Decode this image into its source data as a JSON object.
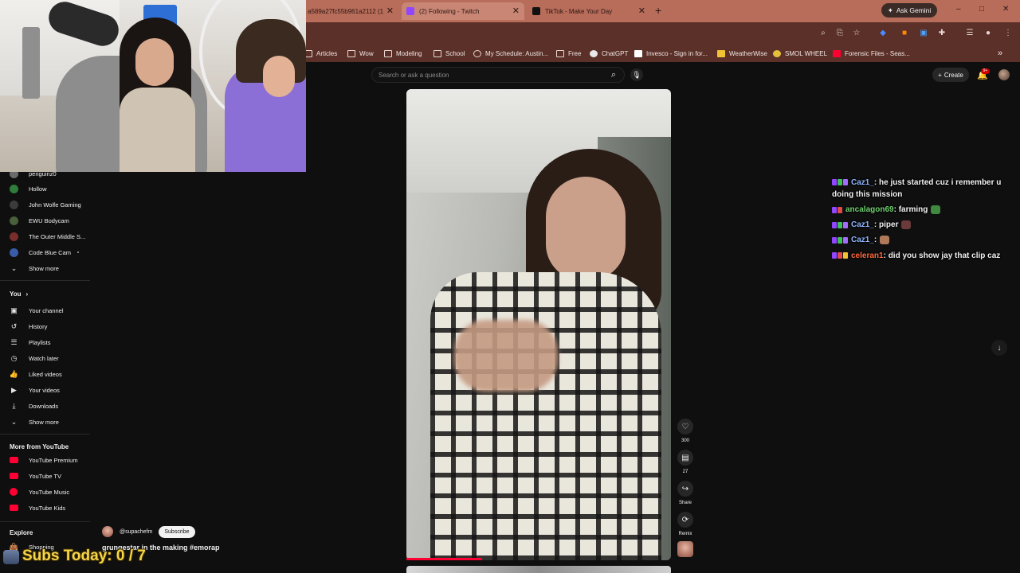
{
  "browser": {
    "tabs": [
      {
        "title": "a589a27fc55b961a2112 (1",
        "active": false,
        "icon_color": "#8a3b2e"
      },
      {
        "title": "(2) Following - Twitch",
        "active": true,
        "icon_color": "#9146ff"
      },
      {
        "title": "TikTok - Make Your Day",
        "active": false,
        "icon_color": "#111111"
      }
    ],
    "new_tab": "+",
    "ask_gemini": "Ask Gemini",
    "win_controls": [
      "–",
      "□",
      "✕"
    ],
    "bookmarks": [
      "Articles",
      "Wow",
      "Modeling",
      "School",
      "My Schedule: Austin...",
      "Free",
      "ChatGPT",
      "Invesco - Sign in for...",
      "WeatherWise",
      "SMOL WHEEL",
      "Forensic Files - Seas..."
    ],
    "bookmarks_more": "»"
  },
  "youtube": {
    "search_placeholder": "Search or ask a question",
    "create_label": "Create",
    "notif_count": "9+",
    "sidebar": {
      "subscriptions": [
        {
          "label": "penguinz0",
          "color": "#6b6b6b"
        },
        {
          "label": "Hollow",
          "color": "#2f7d3a"
        },
        {
          "label": "John Wolfe Gaming",
          "color": "#3b3b3b"
        },
        {
          "label": "EWU Bodycam",
          "color": "#4a5f3b"
        },
        {
          "label": "The Outer Middle S...",
          "color": "#7a2d2d"
        },
        {
          "label": "Code Blue Cam",
          "color": "#3a5ba8"
        }
      ],
      "subs_show_more": "Show more",
      "you_heading": "You",
      "you_items": [
        "Your channel",
        "History",
        "Playlists",
        "Watch later",
        "Liked videos",
        "Your videos",
        "Downloads",
        "Show more"
      ],
      "more_heading": "More from YouTube",
      "more_items": [
        "YouTube Premium",
        "YouTube TV",
        "YouTube Music",
        "YouTube Kids"
      ],
      "explore_heading": "Explore",
      "explore_items": [
        "Shopping"
      ]
    },
    "short": {
      "like_count": "300",
      "comment_count": "27",
      "share_label": "Share",
      "remix_label": "Remix",
      "channel": "@supachefm",
      "subscribe_label": "Subscribe",
      "caption": "grungestar in the making #emorap",
      "progress": 0.29
    }
  },
  "overlay": {
    "subs_today": "Subs Today: 0 / 7"
  },
  "chat": [
    {
      "user": "Caz1_",
      "user_color": "#8fb4ff",
      "text": ": he just started cuz i remember u doing this mission",
      "emote": null
    },
    {
      "user": "ancalagon69",
      "user_color": "#6fcf6f",
      "text": ": farming",
      "emote": "#3f8a3f"
    },
    {
      "user": "Caz1_",
      "user_color": "#8fb4ff",
      "text": ": piper",
      "emote": "#6b3b3b"
    },
    {
      "user": "Caz1_",
      "user_color": "#8fb4ff",
      "text": ":",
      "emote": "#b07a5a"
    },
    {
      "user": "celeran1",
      "user_color": "#ff6a3d",
      "text": ": did you show jay that clip caz",
      "emote": null
    }
  ]
}
